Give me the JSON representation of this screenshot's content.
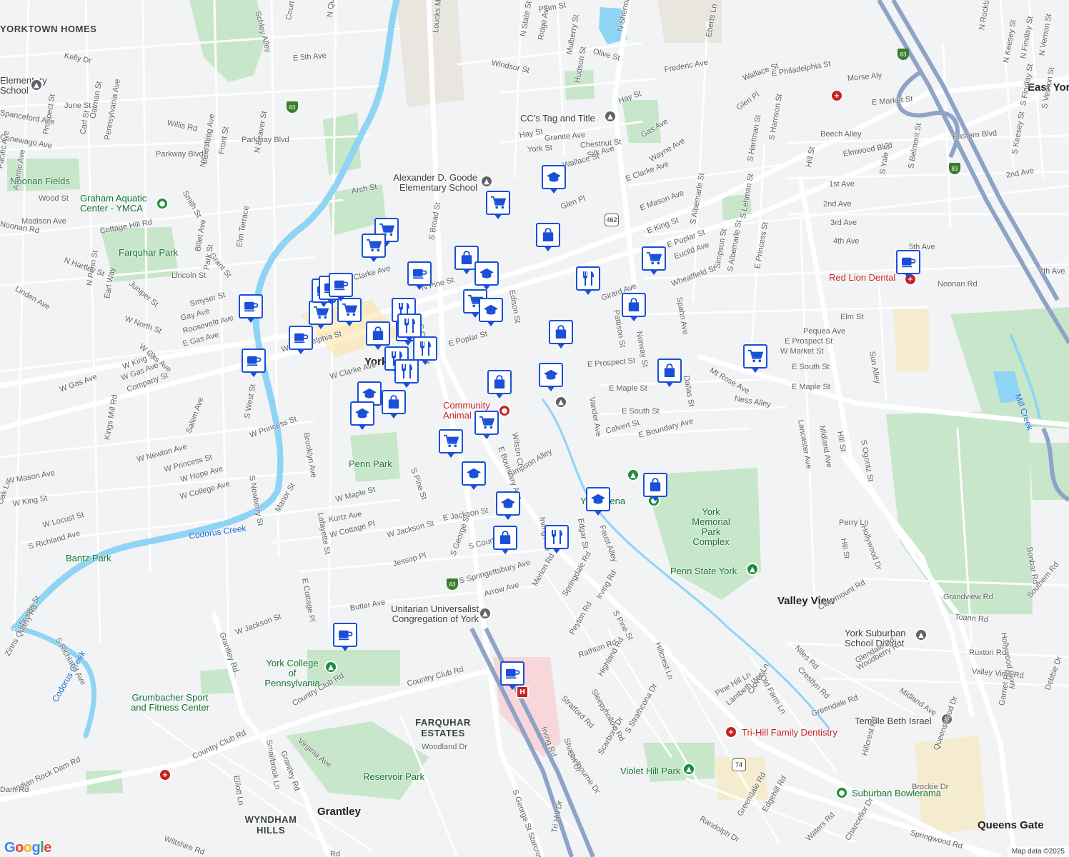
{
  "map": {
    "attribution": "Map data ©2025",
    "logo": [
      "G",
      "o",
      "o",
      "g",
      "l",
      "e"
    ],
    "logo_colors": [
      "#4285f4",
      "#ea4335",
      "#fbbc05",
      "#4285f4",
      "#34a853",
      "#ea4335"
    ]
  },
  "colors": {
    "marker_border": "#1a4fd8",
    "park": "#c8e6c9",
    "water": "#8fd4f5",
    "road_major": "#ffffff",
    "road_highlight": "#fde293",
    "background": "#f1f3f4"
  },
  "areas": [
    {
      "id": "yorktown",
      "text": "YORKTOWN HOMES"
    },
    {
      "id": "farquhar-estates",
      "text": "FARQUHAR ESTATES"
    },
    {
      "id": "wyndham",
      "text": "WYNDHAM HILLS"
    },
    {
      "id": "grantley",
      "text": "Grantley"
    },
    {
      "id": "valley-view",
      "text": "Valley View"
    },
    {
      "id": "queens-gate",
      "text": "Queens Gate"
    },
    {
      "id": "east-york",
      "text": "East York"
    },
    {
      "id": "york",
      "text": "York"
    }
  ],
  "places": [
    {
      "id": "elementary-school",
      "text": "Elementary School"
    },
    {
      "id": "noonan",
      "text": "Noonan Fields"
    },
    {
      "id": "graham",
      "text": "Graham Aquatic Center - YMCA"
    },
    {
      "id": "farquhar",
      "text": "Farquhar Park"
    },
    {
      "id": "cc-tag",
      "text": "CC's Tag and Title"
    },
    {
      "id": "goode",
      "text": "Alexander D. Goode Elementary School"
    },
    {
      "id": "community-animal",
      "text": "Community Animal Ho"
    },
    {
      "id": "penn-park",
      "text": "Penn Park"
    },
    {
      "id": "bantz",
      "text": "Bantz Park"
    },
    {
      "id": "york-arena",
      "text": "York Arena"
    },
    {
      "id": "memorial-park",
      "text": "York Memorial Park Complex"
    },
    {
      "id": "penn-state",
      "text": "Penn State York"
    },
    {
      "id": "unitarian",
      "text": "Unitarian Universalist Congregation of York"
    },
    {
      "id": "ycp",
      "text": "York College of Pennsylvania"
    },
    {
      "id": "grumbacher",
      "text": "Grumbacher Sport and Fitness Center"
    },
    {
      "id": "reservoir",
      "text": "Reservoir Park"
    },
    {
      "id": "violet-hill",
      "text": "Violet Hill Park"
    },
    {
      "id": "tri-hill",
      "text": "Tri-Hill Family Dentistry"
    },
    {
      "id": "suburban",
      "text": "Suburban Bowlerama"
    },
    {
      "id": "temple",
      "text": "Temple Beth Israel"
    },
    {
      "id": "ysd",
      "text": "York Suburban School District"
    },
    {
      "id": "red-lion",
      "text": "Red Lion Dental"
    },
    {
      "id": "codorus-1",
      "text": "Codorus Creek"
    },
    {
      "id": "codorus-2",
      "text": "Codorus Creek"
    },
    {
      "id": "mill-creek",
      "text": "Mill Creek"
    }
  ],
  "streets": [
    "Schley Alley",
    "Court St",
    "N Queen St",
    "Loucks Mill Rd",
    "Plum St",
    "N State St",
    "Ridge Ave",
    "Mulberry St",
    "Olive St",
    "N Sherman St",
    "Eberts Ln",
    "Wallace St",
    "N Rockburn St",
    "N Keesey St",
    "N Findlay St",
    "N Vernon St",
    "Kelly Dr",
    "E 5th Ave",
    "Windsor St",
    "Frederic Ave",
    "E Philadelphia St",
    "Morse Aly",
    "June St",
    "Willis Rd",
    "Parkway Blvd",
    "Hudson St",
    "Hay St",
    "E Market St",
    "Glen Pl",
    "Gas Ave",
    "Beech Alley",
    "Eastern Blvd",
    "S Findlay St",
    "S Vernon St",
    "Elmwood Blvd",
    "Granite Ave",
    "Chestnut St",
    "Silk Ave",
    "Wallace St",
    "York St",
    "Hay St",
    "E Clarke Ave",
    "Wayne Ave",
    "S Hartman St",
    "S Harrison St",
    "2nd Ave",
    "1st Ave",
    "Hill St",
    "S Yale St",
    "S Belmont St",
    "S Keesey St",
    "Arch St",
    "Glen Pl",
    "E Mason Ave",
    "E King St",
    "S Albemarle St",
    "S Lehman St",
    "2nd Ave",
    "3rd Ave",
    "4th Ave",
    "5th Ave",
    "7th Ave",
    "Noonan Rd",
    "Madison Ave",
    "Cottage Hill Rd",
    "Elm Terrace",
    "N Hartley St",
    "Linden Ave",
    "N Penn St",
    "Juniper St",
    "Billet Ave",
    "Grant St",
    "Park St",
    "Lincoln St",
    "Earl Way",
    "W North St",
    "Smyser St",
    "Gay Ave",
    "Rooseveltt Ave",
    "W Gas Ave",
    "E Gas Ave",
    "E Clarke Ave",
    "N Pine St",
    "S Broad St",
    "Edison St",
    "E Poplar St",
    "Euclid Ave",
    "Wheatfield St",
    "Simpson St",
    "S Albemarle St",
    "E Princess St",
    "Girard Ave",
    "Pattison St",
    "Norway St",
    "Spahn Ave",
    "Elm St",
    "Pequea Ave",
    "E Prospect St",
    "W Market St",
    "W Philadelphia St",
    "W Gas Ave",
    "W King St",
    "W Clarke Ave",
    "Company St",
    "W Gas Ave",
    "E Poplar St",
    "S Queen St",
    "E Prospect St",
    "Mt Rose Ave",
    "E South St",
    "E Maple St",
    "Ness Alley",
    "Vander Ave",
    "E South St",
    "Dallas St",
    "E Maple St",
    "Lancaster Ave",
    "Midland Ave",
    "Hill St",
    "S Ogontz St",
    "Sun Alley",
    "W Princess St",
    "W Newton Ave",
    "Salem Ave",
    "W Mason Ave",
    "W King St",
    "W Princess St",
    "W Hope Ave",
    "W College Ave",
    "W Locust St",
    "S Richland Ave",
    "Oak Ln",
    "Brooklyn Ave",
    "S Newberry St",
    "S West St",
    "Kings Mill Rd",
    "Manor St",
    "Lafayette St",
    "W Maple St",
    "Kurtz Ave",
    "W Cottage Pl",
    "W Jackson St",
    "Jessop Pl",
    "E Cottage Pl",
    "E Jackson St",
    "S Court Ave",
    "S George St",
    "S Pine St",
    "Wilson Ct",
    "E Boundary Ave",
    "Simpson Alley",
    "E Boundary Ave",
    "Calvert St",
    "Edgar St",
    "Faust Alley",
    "Irving Ave",
    "Perry Ln",
    "Hill St",
    "Hollywood Dr",
    "Bonbar Rd",
    "Grandview Rd",
    "Southern Rd",
    "Toann Rd",
    "Hollywood Pkwy",
    "Clearmount Rd",
    "Niles Rd",
    "Crestlyn Rd",
    "Glendale Rd",
    "Woodberry Rd",
    "Ruxton Rd",
    "Valley View Rd",
    "Midland Ave",
    "Debbie Dr",
    "Garnet Rd",
    "Queenswood Dr",
    "Greendale Rd",
    "Hillcrest Rd",
    "S Springettsbury Ave",
    "Arrow Ave",
    "Merion Rd",
    "Springdale Rd",
    "Irving Rd",
    "S Pine St",
    "Peyton Rd",
    "Rathton Rd",
    "Highland Rd",
    "Sleepyhollow Rd",
    "Stratford Rd",
    "Irving Rd",
    "Sharon Dr",
    "Shelbourne Dr",
    "Scarboro Dr",
    "S Strathcona Dr",
    "Hillcrest Ln",
    "Pine Hill Ln",
    "Lambeth Walk",
    "Clover Ln",
    "Old Farm Ln",
    "Butler Ave",
    "W Jackson St",
    "Lafayette St",
    "Zinns Quarry Rd",
    "S Richland Ave",
    "Grantley Rd",
    "Country Club Rd",
    "Country Club Rd",
    "Country Club Rd",
    "Indian Rock Dam Rd",
    "Smallbrook Ln",
    "Elliott Ln",
    "Grantley Rd",
    "Virginia Ave",
    "Woodland Dr",
    "S George St Starcross",
    "Tri Hill Dr",
    "Randolph Dr",
    "Greendale Rd",
    "Edgehill Rd",
    "Waters Rd",
    "Chancellor Dr",
    "Springwood Rd",
    "Brockie Dr",
    "Wiltshire Rd",
    "Dam Rd",
    "Rd",
    "Spanceford Ave",
    "Conewago Ave",
    "Prospect St",
    "Oatman St",
    "Carl St",
    "Pennsylvania Ave",
    "Bare Ave",
    "N Pershing Ave",
    "Front St",
    "N Beaver St",
    "Smith St",
    "Parkway Blvd",
    "Atlantic Ave",
    "Pacific Ave",
    "Wood St",
    "Noonan Rd"
  ],
  "markers": [
    {
      "kind": "cart"
    },
    {
      "kind": "cart"
    },
    {
      "kind": "cart"
    },
    {
      "kind": "cart"
    },
    {
      "kind": "cart"
    },
    {
      "kind": "cart"
    },
    {
      "kind": "cart"
    },
    {
      "kind": "cart"
    },
    {
      "kind": "cart"
    },
    {
      "kind": "cart"
    },
    {
      "kind": "cup"
    },
    {
      "kind": "cup"
    },
    {
      "kind": "cup"
    },
    {
      "kind": "cup"
    },
    {
      "kind": "cup"
    },
    {
      "kind": "cup"
    },
    {
      "kind": "cup"
    },
    {
      "kind": "cup"
    },
    {
      "kind": "cup"
    },
    {
      "kind": "cup"
    },
    {
      "kind": "bag"
    },
    {
      "kind": "bag"
    },
    {
      "kind": "bag"
    },
    {
      "kind": "bag"
    },
    {
      "kind": "bag"
    },
    {
      "kind": "bag"
    },
    {
      "kind": "bag"
    },
    {
      "kind": "bag"
    },
    {
      "kind": "bag"
    },
    {
      "kind": "bag"
    },
    {
      "kind": "bag"
    },
    {
      "kind": "cap"
    },
    {
      "kind": "cap"
    },
    {
      "kind": "cap"
    },
    {
      "kind": "cap"
    },
    {
      "kind": "cap"
    },
    {
      "kind": "cap"
    },
    {
      "kind": "cap"
    },
    {
      "kind": "cap"
    },
    {
      "kind": "cap"
    },
    {
      "kind": "fork"
    },
    {
      "kind": "fork"
    },
    {
      "kind": "fork"
    },
    {
      "kind": "fork"
    },
    {
      "kind": "fork"
    },
    {
      "kind": "fork"
    },
    {
      "kind": "fork"
    }
  ],
  "shields": [
    {
      "id": "i83-n",
      "text": "83"
    },
    {
      "id": "i83-e",
      "text": "83"
    },
    {
      "id": "i83-s",
      "text": "83"
    },
    {
      "id": "i83-sw",
      "text": "83"
    },
    {
      "id": "pa462",
      "text": "462"
    },
    {
      "id": "pa74",
      "text": "74"
    }
  ]
}
